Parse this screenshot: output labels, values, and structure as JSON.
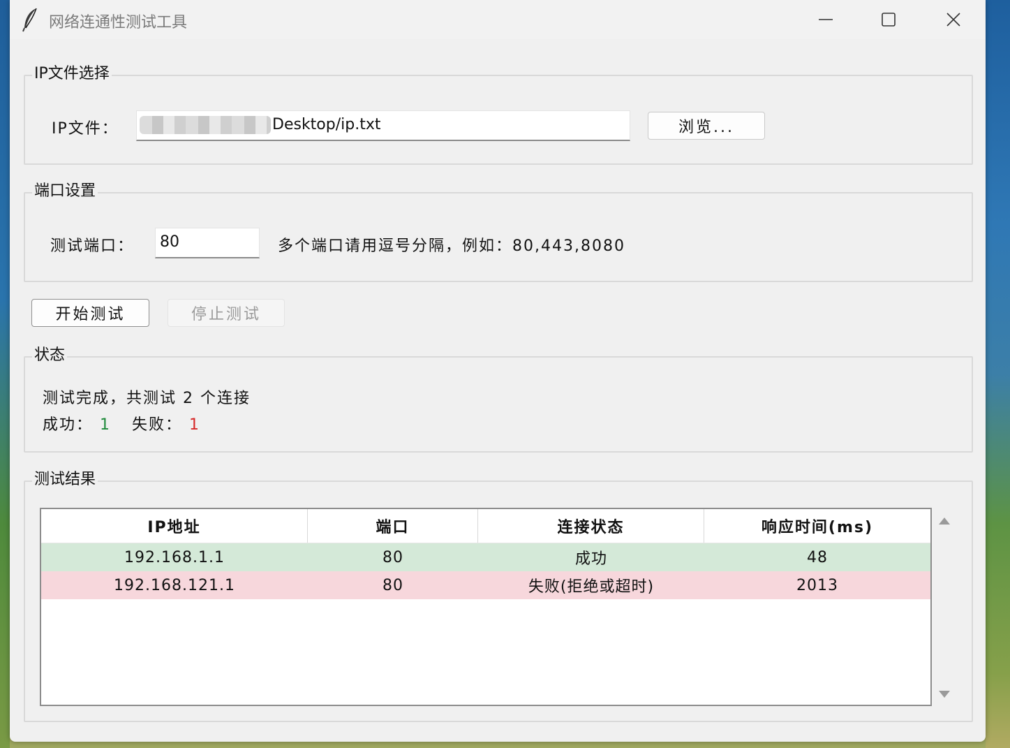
{
  "window": {
    "title": "网络连通性测试工具"
  },
  "file_group": {
    "label": "IP文件选择",
    "field_label": "IP文件：",
    "file_path_visible": "Desktop/ip.txt",
    "browse_label": "浏览..."
  },
  "port_group": {
    "label": "端口设置",
    "field_label": "测试端口：",
    "port_value": "80",
    "hint": "多个端口请用逗号分隔，例如：80,443,8080"
  },
  "actions": {
    "start_label": "开始测试",
    "stop_label": "停止测试"
  },
  "status_group": {
    "label": "状态",
    "summary": "测试完成，共测试 2 个连接",
    "success_label": "成功：",
    "success_count": "1",
    "fail_label": "失败：",
    "fail_count": "1"
  },
  "results_group": {
    "label": "测试结果",
    "columns": [
      "IP地址",
      "端口",
      "连接状态",
      "响应时间(ms)"
    ],
    "rows": [
      {
        "ip": "192.168.1.1",
        "port": "80",
        "status": "成功",
        "time": "48",
        "state": "success"
      },
      {
        "ip": "192.168.121.1",
        "port": "80",
        "status": "失败(拒绝或超时)",
        "time": "2013",
        "state": "fail"
      }
    ]
  },
  "colors": {
    "success_row": "#d4e9d8",
    "fail_row": "#f7d7dc",
    "success_text": "#1e8a3a",
    "fail_text": "#d62828"
  }
}
